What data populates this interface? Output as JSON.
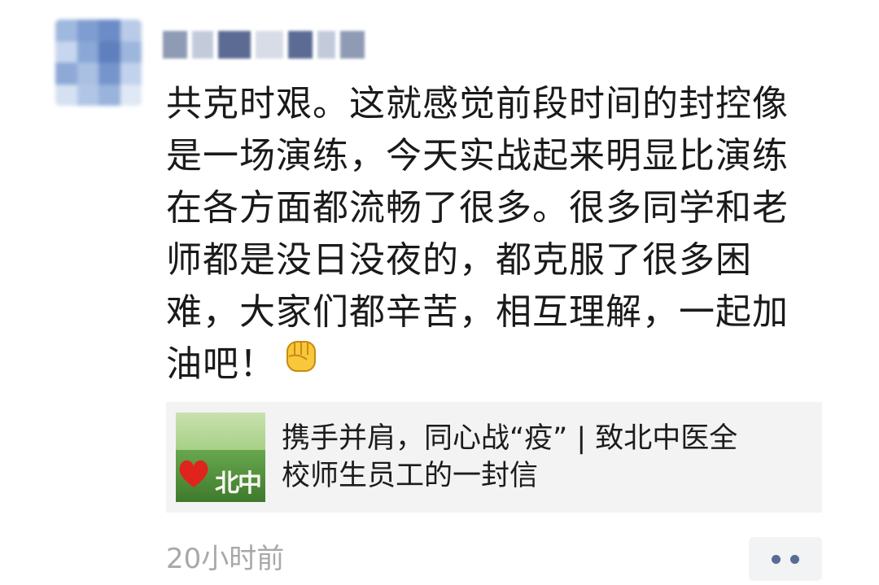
{
  "post": {
    "text_lines": [
      "共克时艰。这就感觉前段时间的封控像",
      "是一场演练，今天实战起来明显比演练",
      "在各方面都流畅了很多。很多同学和老",
      "师都是没日没夜的，都克服了很多困",
      "难，大家们都辛苦，相互理解，一起加",
      "油吧！"
    ],
    "emoji_icon": "fist-emoji",
    "avatar_colors": [
      "#6f8fc4",
      "#8aa7d6",
      "#b7cbe6",
      "#5b7cb8"
    ],
    "nickname_colors": [
      "#8f9bb5",
      "#5b6b94",
      "#c3cbdb"
    ]
  },
  "link_card": {
    "title_lines": [
      "携手并肩，同心战“疫” | 致北中医全",
      "校师生员工的一封信"
    ],
    "thumbnail_chars": "北中",
    "thumbnail_icon": "heart-icon"
  },
  "footer": {
    "timestamp": "20小时前",
    "more_icon": "more-dots-icon",
    "more_color": "#576b95"
  }
}
